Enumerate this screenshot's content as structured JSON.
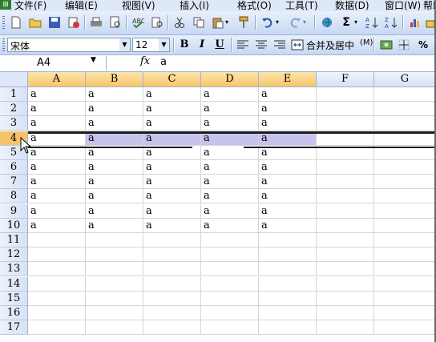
{
  "menu": {
    "items": [
      "文件(F)",
      "编辑(E)",
      "视图(V)",
      "插入(I)",
      "格式(O)",
      "工具(T)",
      "数据(D)",
      "窗口(W)",
      "帮助(H)"
    ]
  },
  "toolbar": {
    "sigma": "Σ"
  },
  "format_toolbar": {
    "font_name": "宋体",
    "font_size": "12",
    "bold": "B",
    "italic": "I",
    "underline": "U",
    "merge_center_label": "合并及居中",
    "merge_center_shortcut": "(M)",
    "percent": "%"
  },
  "formula_bar": {
    "name_box": "A4",
    "fx": "fx",
    "content": "a"
  },
  "sheet": {
    "columns": [
      "A",
      "B",
      "C",
      "D",
      "E",
      "F",
      "G"
    ],
    "rows": [
      "1",
      "2",
      "3",
      "4",
      "5",
      "6",
      "7",
      "8",
      "9",
      "10",
      "11",
      "12",
      "13",
      "14",
      "15",
      "16",
      "17"
    ],
    "selected_row": "4",
    "cells": [
      [
        "a",
        "a",
        "a",
        "a",
        "a"
      ],
      [
        "a",
        "a",
        "a",
        "a",
        "a"
      ],
      [
        "a",
        "a",
        "a",
        "a",
        "a"
      ],
      [
        "a",
        "a",
        "a",
        "a",
        "a"
      ],
      [
        "a",
        "a",
        "a",
        "a",
        "a"
      ],
      [
        "a",
        "a",
        "a",
        "a",
        "a"
      ],
      [
        "a",
        "a",
        "a",
        "a",
        "a"
      ],
      [
        "a",
        "a",
        "a",
        "a",
        "a"
      ],
      [
        "a",
        "a",
        "a",
        "a",
        "a"
      ],
      [
        "a",
        "a",
        "a",
        "a",
        "a"
      ]
    ]
  },
  "colors": {
    "header_highlight": "#f6c66b",
    "row_highlight": "#c6c3ec",
    "toolbar_blue": "#c7d8f2"
  }
}
